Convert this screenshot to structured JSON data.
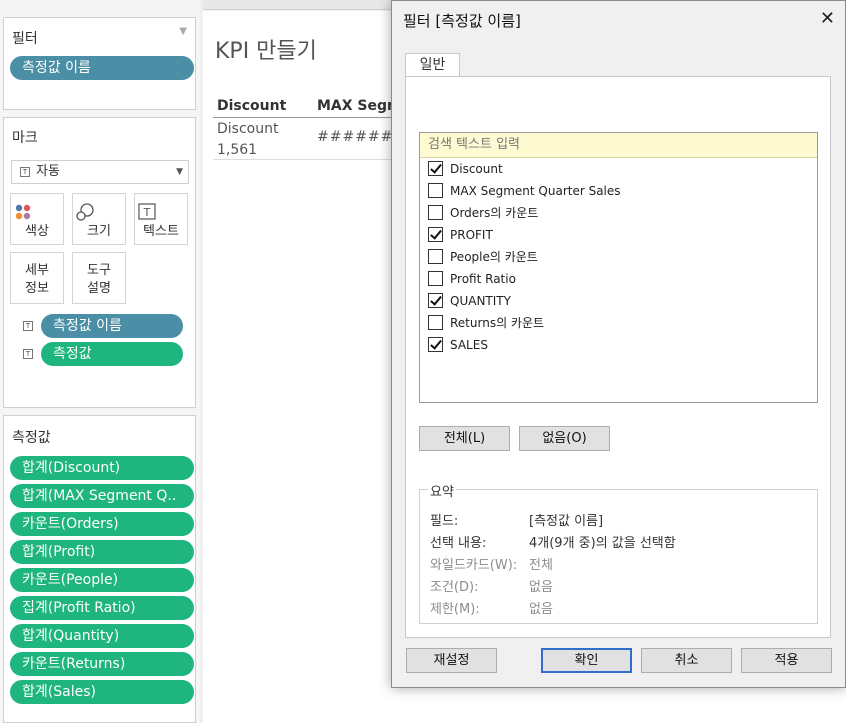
{
  "filter_shelf": {
    "title": "필터",
    "pill": "측정값 이름"
  },
  "marks_card": {
    "title": "마크",
    "mark_type": "자동",
    "buttons": {
      "color": "색상",
      "size": "크기",
      "text": "텍스트",
      "detail_1": "세부",
      "detail_2": "정보",
      "tooltip_1": "도구",
      "tooltip_2": "설명"
    },
    "pills": [
      "측정값 이름",
      "측정값"
    ]
  },
  "measure_values_card": {
    "title": "측정값",
    "pills": [
      "합계(Discount)",
      "합계(MAX Segment Q..",
      "카운트(Orders)",
      "합계(Profit)",
      "카운트(People)",
      "집계(Profit Ratio)",
      "합계(Quantity)",
      "카운트(Returns)",
      "합계(Sales)"
    ]
  },
  "view": {
    "title": "KPI 만들기",
    "headers": [
      "Discount",
      "MAX Segm"
    ],
    "cell1_line1": "Discount",
    "cell1_line2": "1,561",
    "cell2": "########"
  },
  "dialog": {
    "title": "필터 [측정값 이름]",
    "tab": "일반",
    "search_placeholder": "검색 텍스트 입력",
    "items": [
      {
        "label": "Discount",
        "checked": true
      },
      {
        "label": "MAX Segment Quarter Sales",
        "checked": false
      },
      {
        "label": "Orders의 카운트",
        "checked": false
      },
      {
        "label": "PROFIT",
        "checked": true
      },
      {
        "label": "People의 카운트",
        "checked": false
      },
      {
        "label": "Profit Ratio",
        "checked": false
      },
      {
        "label": "QUANTITY",
        "checked": true
      },
      {
        "label": "Returns의 카운트",
        "checked": false
      },
      {
        "label": "SALES",
        "checked": true
      }
    ],
    "all_button": "전체(L)",
    "none_button": "없음(O)",
    "summary": {
      "legend": "요약",
      "field_key": "필드:",
      "field_val": "[측정값 이름]",
      "selection_key": "선택 내용:",
      "selection_val": "4개(9개 중)의 값을 선택함",
      "wildcard_key": "와일드카드(W):",
      "wildcard_val": "전체",
      "condition_key": "조건(D):",
      "condition_val": "없음",
      "limit_key": "제한(M):",
      "limit_val": "없음"
    },
    "reset_button": "재설정",
    "ok_button": "확인",
    "cancel_button": "취소",
    "apply_button": "적용"
  },
  "colors": {
    "pill_blue": "#4a8fa6",
    "pill_green": "#1fb57f",
    "search_bg": "#fefbd2",
    "default_button_border": "#2f6fc9"
  }
}
